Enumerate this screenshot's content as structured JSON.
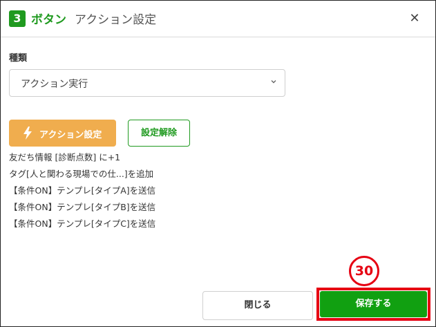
{
  "header": {
    "step_number": "3",
    "title_strong": "ボタン",
    "title_rest": "アクション設定",
    "close_glyph": "✕"
  },
  "form": {
    "type_label": "種類",
    "type_value": "アクション実行"
  },
  "actions": {
    "set_action_label": "アクション設定",
    "clear_label": "設定解除"
  },
  "summary_lines": [
    "友だち情報 [診断点数] に+1",
    "タグ[人と関わる現場での仕...]を追加",
    "【条件ON】テンプレ[タイプA]を送信",
    "【条件ON】テンプレ[タイプB]を送信",
    "【条件ON】テンプレ[タイプC]を送信"
  ],
  "annotation": "30",
  "footer": {
    "close_label": "閉じる",
    "save_label": "保存する"
  },
  "colors": {
    "brand_green": "#1f9a1f",
    "save_green": "#11a011",
    "action_orange": "#f0ad4e",
    "annotation_red": "#e60012"
  },
  "icons": {
    "bolt": "lightning-bolt",
    "chevron": "chevron-down",
    "close": "close-x"
  }
}
